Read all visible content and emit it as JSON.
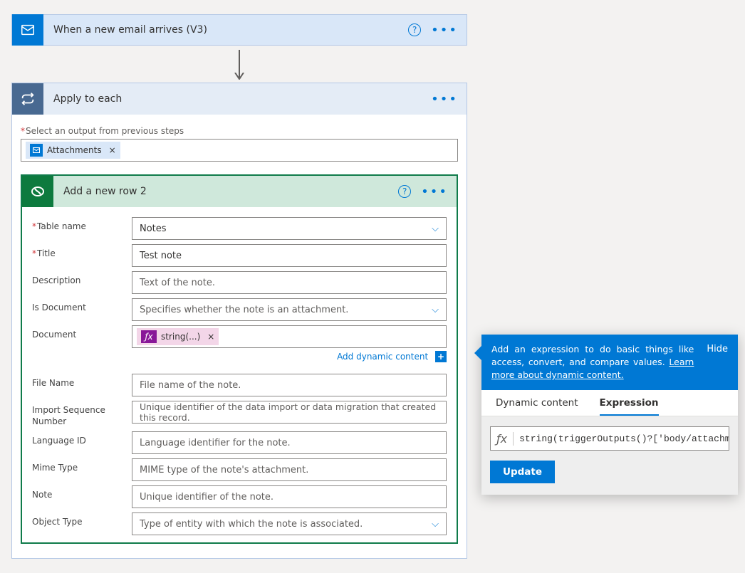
{
  "trigger": {
    "title": "When a new email arrives (V3)"
  },
  "apply": {
    "title": "Apply to each",
    "select_label": "Select an output from previous steps",
    "token": "Attachments"
  },
  "row_card": {
    "title": "Add a new row 2",
    "fields": {
      "table_label": "Table name",
      "table_value": "Notes",
      "title_label": "Title",
      "title_value": "Test note",
      "desc_label": "Description",
      "desc_ph": "Text of the note.",
      "isdoc_label": "Is Document",
      "isdoc_ph": "Specifies whether the note is an attachment.",
      "doc_label": "Document",
      "doc_token": "string(...)",
      "add_dynamic": "Add dynamic content",
      "file_label": "File Name",
      "file_ph": "File name of the note.",
      "import_label": "Import Sequence Number",
      "import_ph": "Unique identifier of the data import or data migration that created this record.",
      "lang_label": "Language ID",
      "lang_ph": "Language identifier for the note.",
      "mime_label": "Mime Type",
      "mime_ph": "MIME type of the note's attachment.",
      "note_label": "Note",
      "note_ph": "Unique identifier of the note.",
      "obj_label": "Object Type",
      "obj_ph": "Type of entity with which the note is associated."
    }
  },
  "flyout": {
    "banner_text": "Add an expression to do basic things like access, convert, and compare values. ",
    "banner_link": "Learn more about dynamic content.",
    "hide": "Hide",
    "tab_dynamic": "Dynamic content",
    "tab_expression": "Expression",
    "expression": "string(triggerOutputs()?['body/attachments",
    "update": "Update"
  }
}
